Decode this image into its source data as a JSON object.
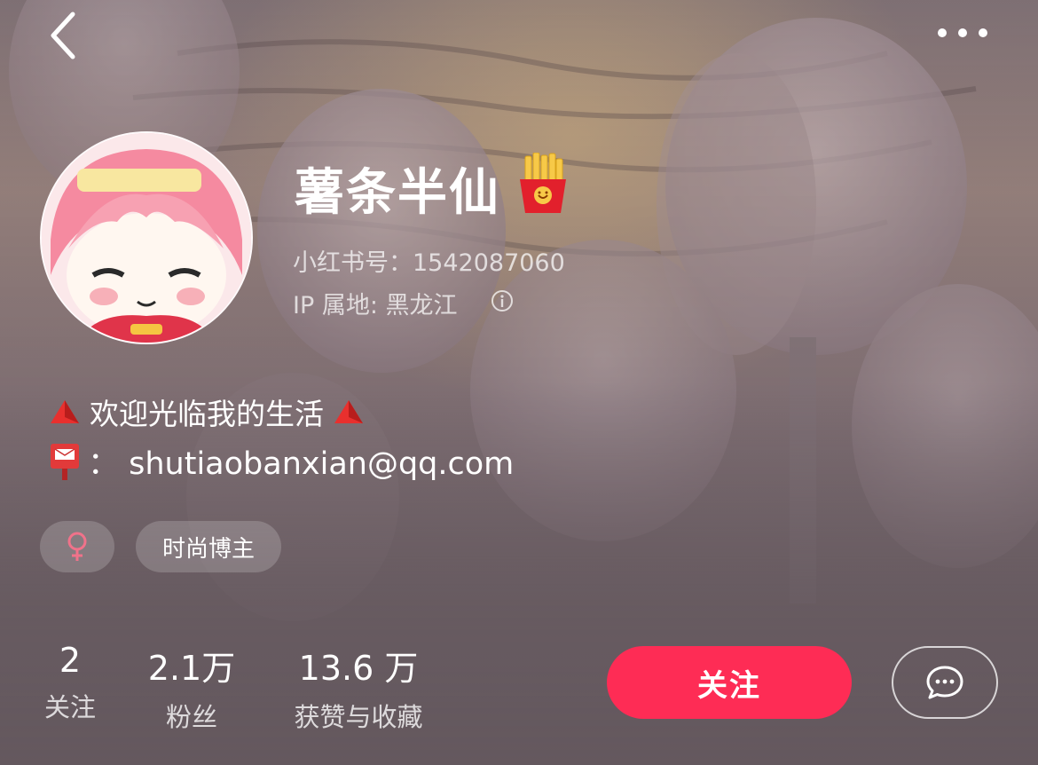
{
  "profile": {
    "name": "薯条半仙",
    "redbook_id": "小红书号：1542087060",
    "ip_location": "IP 属地: 黑龙江",
    "bio_line1": "欢迎光临我的生活",
    "bio_line2": "： shutiaobanxian@qq.com"
  },
  "tags": {
    "gender_symbol": "♀",
    "gender_color": "#f0728a",
    "category": "时尚博主"
  },
  "stats": [
    {
      "value": "2",
      "label": "关注"
    },
    {
      "value": "2.1万",
      "label": "粉丝"
    },
    {
      "value": "13.6 万",
      "label": "获赞与收藏"
    }
  ],
  "actions": {
    "follow_label": "关注",
    "follow_color": "#fe2c55"
  },
  "icons": {
    "back": "chevron-left-icon",
    "more": "more-dots-icon",
    "name_emoji": "french-fries-icon",
    "info": "info-icon",
    "bio_emoji": "red-triangle-icon",
    "mail_emoji": "mailbox-icon",
    "chat": "chat-bubble-icon"
  }
}
